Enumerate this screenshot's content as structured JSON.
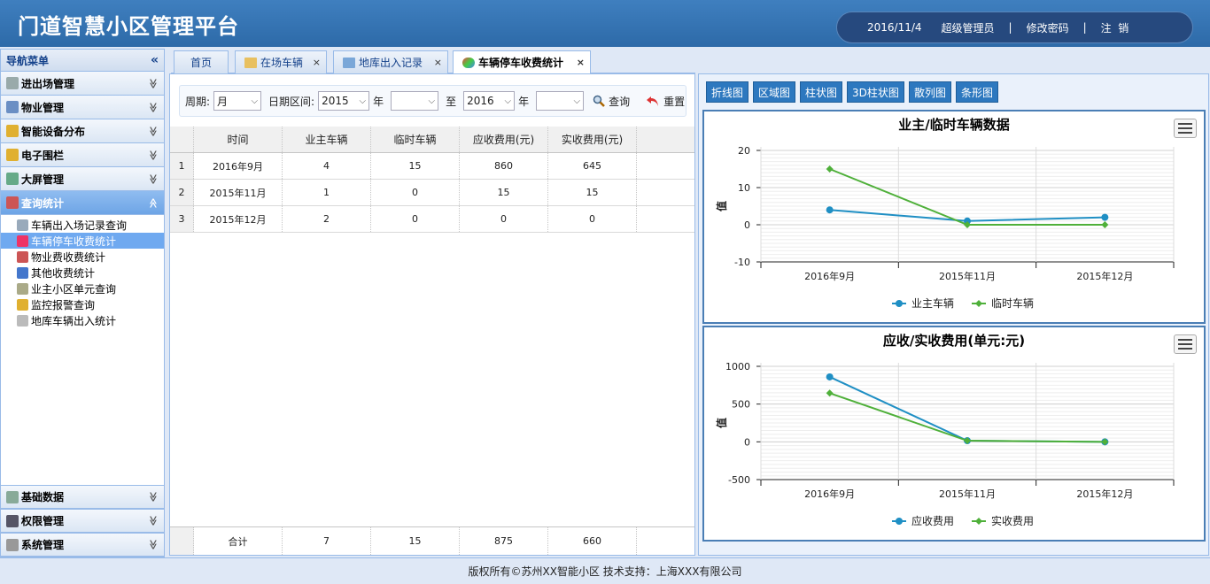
{
  "app": {
    "title": "门道智慧小区管理平台"
  },
  "userbar": {
    "date": "2016/11/4",
    "role": "超级管理员",
    "sep": "|",
    "change_pwd": "修改密码",
    "logout": "注  销"
  },
  "sidebar": {
    "title": "导航菜单",
    "collapse": "«",
    "sections": [
      {
        "label": "进出场管理",
        "icon": "car-icon",
        "color": "#9aa"
      },
      {
        "label": "物业管理",
        "icon": "form-icon",
        "color": "#6b8fc4"
      },
      {
        "label": "智能设备分布",
        "icon": "key-icon",
        "color": "#e0b030"
      },
      {
        "label": "电子围栏",
        "icon": "key-icon",
        "color": "#e0b030"
      },
      {
        "label": "大屏管理",
        "icon": "screen-icon",
        "color": "#6a8"
      },
      {
        "label": "查询统计",
        "icon": "chart-icon",
        "color": "#c55"
      }
    ],
    "sub_items": [
      {
        "label": "车辆出入场记录查询",
        "icon": "search-doc-icon",
        "color": "#9ab"
      },
      {
        "label": "车辆停车收费统计",
        "icon": "pie-icon",
        "color": "#e36"
      },
      {
        "label": "物业费收费统计",
        "icon": "line-chart-icon",
        "color": "#c55"
      },
      {
        "label": "其他收费统计",
        "icon": "bar-chart-icon",
        "color": "#47c"
      },
      {
        "label": "业主小区单元查询",
        "icon": "hourglass-icon",
        "color": "#aa8"
      },
      {
        "label": "监控报警查询",
        "icon": "warning-icon",
        "color": "#e0b030"
      },
      {
        "label": "地库车辆出入统计",
        "icon": "cylinder-icon",
        "color": "#bbb"
      }
    ],
    "bottom_sections": [
      {
        "label": "基础数据",
        "icon": "database-icon",
        "color": "#8a9"
      },
      {
        "label": "权限管理",
        "icon": "monitor-icon",
        "color": "#556"
      },
      {
        "label": "系统管理",
        "icon": "gear-icon",
        "color": "#999"
      }
    ],
    "chevron_down": "≫",
    "chevron_up": "≪"
  },
  "tabs": [
    {
      "label": "首页",
      "icon": "",
      "closable": false
    },
    {
      "label": "在场车辆",
      "icon": "folder-icon",
      "closable": true
    },
    {
      "label": "地库出入记录",
      "icon": "grid-icon",
      "closable": true
    },
    {
      "label": "车辆停车收费统计",
      "icon": "pie-icon",
      "closable": true
    }
  ],
  "tab_close": "×",
  "filter": {
    "period_label": "周期:",
    "period_value": "月",
    "range_label": "日期区间:",
    "from_year": "2015",
    "year_unit": "年",
    "from_month": "",
    "to_label": "至",
    "to_year": "2016",
    "to_month": "",
    "search_btn": "查询",
    "reset_btn": "重置",
    "dropdown": "⌵"
  },
  "grid": {
    "headers": [
      "时间",
      "业主车辆",
      "临时车辆",
      "应收费用(元)",
      "实收费用(元)"
    ],
    "rows": [
      [
        "1",
        "2016年9月",
        "4",
        "15",
        "860",
        "645"
      ],
      [
        "2",
        "2015年11月",
        "1",
        "0",
        "15",
        "15"
      ],
      [
        "3",
        "2015年12月",
        "2",
        "0",
        "0",
        "0"
      ]
    ],
    "total": [
      "合计",
      "7",
      "15",
      "875",
      "660"
    ]
  },
  "chart_buttons": [
    "折线图",
    "区域图",
    "柱状图",
    "3D柱状图",
    "散列图",
    "条形图"
  ],
  "chart_data": [
    {
      "type": "line",
      "title": "业主/临时车辆数据",
      "ylabel": "值",
      "categories": [
        "2016年9月",
        "2015年11月",
        "2015年12月"
      ],
      "ylim": [
        -10,
        20
      ],
      "yticks": [
        -10,
        0,
        10,
        20
      ],
      "series": [
        {
          "name": "业主车辆",
          "color": "#1f8fc4",
          "values": [
            4,
            1,
            2
          ]
        },
        {
          "name": "临时车辆",
          "color": "#4fb03a",
          "values": [
            15,
            0,
            0
          ]
        }
      ]
    },
    {
      "type": "line",
      "title": "应收/实收费用(单元:元)",
      "ylabel": "值",
      "categories": [
        "2016年9月",
        "2015年11月",
        "2015年12月"
      ],
      "ylim": [
        -500,
        1000
      ],
      "yticks": [
        -500,
        0,
        500,
        1000
      ],
      "series": [
        {
          "name": "应收费用",
          "color": "#1f8fc4",
          "values": [
            860,
            15,
            0
          ]
        },
        {
          "name": "实收费用",
          "color": "#4fb03a",
          "values": [
            645,
            15,
            0
          ]
        }
      ]
    }
  ],
  "footer": {
    "text": "版权所有©苏州XX智能小区  技术支持：上海XXX有限公司"
  }
}
